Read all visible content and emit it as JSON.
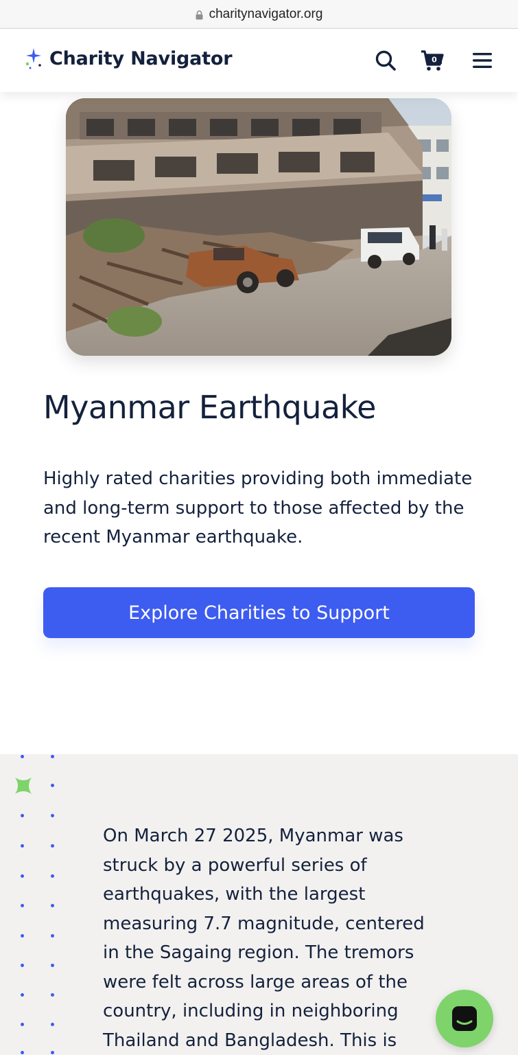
{
  "browser": {
    "url": "charitynavigator.org"
  },
  "header": {
    "brand": "Charity Navigator",
    "cart_count": "0"
  },
  "hero": {
    "title": "Myanmar Earthquake",
    "description": "Highly rated charities providing both immediate and long-term support to those affected by the recent Myanmar earthquake.",
    "cta_label": "Explore Charities to Support"
  },
  "section": {
    "body": "On March 27 2025, Myanmar was struck by a powerful series of earthquakes, with the largest measuring 7.7 magnitude, centered in the Sagaing region. The tremors were felt across large areas of the country, including in neighboring Thailand and Bangladesh. This is"
  },
  "colors": {
    "brand_navy": "#14213d",
    "accent_blue": "#3d5cf0",
    "section_bg": "#f2f1ef",
    "chat_green": "#7ed46a"
  },
  "icons": [
    "lock-icon",
    "logo-sparkle-icon",
    "search-icon",
    "cart-icon",
    "menu-icon",
    "sparkle-decoration-icon",
    "chat-icon"
  ]
}
